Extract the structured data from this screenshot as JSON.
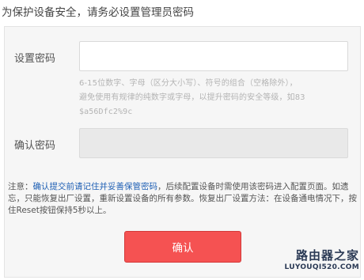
{
  "heading": "为保护设备安全，请务必设置管理员密码",
  "form": {
    "password_label": "设置密码",
    "password_value": "",
    "hint_line1": "6-15位数字、字母（区分大小写）、符号的组合（空格除外），",
    "hint_line2": "避免使用有规律的纯数字或字母，以提升密码的安全等级，如83",
    "hint_line3": "$a56Dfc2%9c",
    "confirm_label": "确认密码",
    "confirm_value": ""
  },
  "note": {
    "prefix": "注意：",
    "highlight": "确认提交前请记住并妥善保管密码",
    "rest": "，后续配置设备时需使用该密码进入配置页面。如遗忘，只能恢复出厂设置，重新设置设备的所有参数。恢复出厂设置方法：在设备通电情况下，按住Reset按钮保持5秒以上。"
  },
  "confirm_button_label": "确认",
  "watermark": {
    "line1": "路由器之家",
    "line2": "LUYOUQI520.COM"
  },
  "colors": {
    "button": "#f55252",
    "note_highlight": "#1e5fb4",
    "panel_bg": "#f6f6f6"
  }
}
